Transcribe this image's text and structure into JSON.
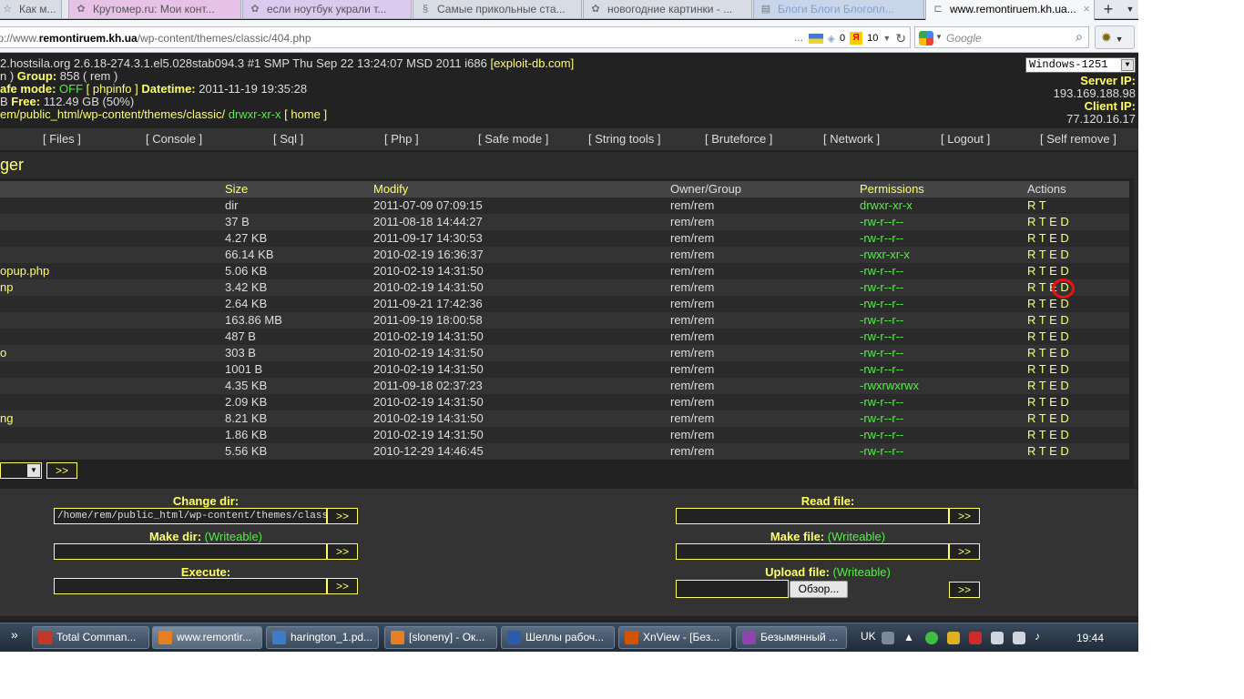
{
  "browser": {
    "tabs": [
      {
        "label": "Как м...",
        "fav": "☆"
      },
      {
        "label": "Крутомер.ru: Мои конт...",
        "fav": "✿"
      },
      {
        "label": "если ноутбук украли т...",
        "fav": "✿"
      },
      {
        "label": "Самые прикольные ста...",
        "fav": "§"
      },
      {
        "label": "новогодние картинки - ...",
        "fav": "✿"
      },
      {
        "label": "Блоги Блоги Блогопл...",
        "fav": "▤"
      },
      {
        "label": "www.remontiruem.kh.ua...",
        "fav": "⊏"
      }
    ],
    "new_tab": "+",
    "url_prefix": "http://www.",
    "url_host": "remontiruem.kh.ua",
    "url_path": "/wp-content/themes/classic/404.php",
    "counter_a": "0",
    "counter_b": "10",
    "search_placeholder": "Google"
  },
  "header": {
    "uname": "2.hostsila.org 2.6.18-274.3.1.el5.028stab094.3 #1 SMP Thu Sep 22 13:24:07 MSD 2011 i686",
    "exploit_link": "[exploit-db.com]",
    "user_tail": "n ) ",
    "group_label": "Group:",
    "group_value": "858 ( rem )",
    "safe_label": "afe mode:",
    "safe_value": "OFF",
    "phpinfo": "[ phpinfo ]",
    "datetime_label": "Datetime:",
    "datetime_value": "2011-11-19 19:35:28",
    "free_prefix": "B",
    "free_label": "Free:",
    "free_value": "112.49 GB (50%)",
    "path": "em/public_html/wp-content/themes/classic/",
    "path_perm": "drwxr-xr-x",
    "home_link": "[ home ]",
    "encoding": "Windows-1251",
    "server_ip_label": "Server IP:",
    "server_ip": "193.169.188.98",
    "client_ip_label": "Client IP:",
    "client_ip": "77.120.16.17"
  },
  "menu": [
    "[ Files ]",
    "[ Console ]",
    "[ Sql ]",
    "[ Php ]",
    "[ Safe mode ]",
    "[ String tools ]",
    "[ Bruteforce ]",
    "[ Network ]",
    "[ Logout ]",
    "[ Self remove ]"
  ],
  "section_title": "ger",
  "table": {
    "columns": [
      "Size",
      "Modify",
      "Owner/Group",
      "Permissions",
      "Actions"
    ],
    "rows": [
      {
        "name": "",
        "size": "dir",
        "modify": "2011-07-09 07:09:15",
        "owner": "rem/rem",
        "perms": "drwxr-xr-x",
        "actions": "R T"
      },
      {
        "name": "",
        "size": "37 B",
        "modify": "2011-08-18 14:44:27",
        "owner": "rem/rem",
        "perms": "-rw-r--r--",
        "actions": "R T E D"
      },
      {
        "name": "",
        "size": "4.27 KB",
        "modify": "2011-09-17 14:30:53",
        "owner": "rem/rem",
        "perms": "-rw-r--r--",
        "actions": "R T E D"
      },
      {
        "name": "",
        "size": "66.14 KB",
        "modify": "2010-02-19 16:36:37",
        "owner": "rem/rem",
        "perms": "-rwxr-xr-x",
        "actions": "R T E D"
      },
      {
        "name": "opup.php",
        "size": "5.06 KB",
        "modify": "2010-02-19 14:31:50",
        "owner": "rem/rem",
        "perms": "-rw-r--r--",
        "actions": "R T E D"
      },
      {
        "name": "np",
        "size": "3.42 KB",
        "modify": "2010-02-19 14:31:50",
        "owner": "rem/rem",
        "perms": "-rw-r--r--",
        "actions": "R T E D"
      },
      {
        "name": "",
        "size": "2.64 KB",
        "modify": "2011-09-21 17:42:36",
        "owner": "rem/rem",
        "perms": "-rw-r--r--",
        "actions": "R T E D"
      },
      {
        "name": "",
        "size": "163.86 MB",
        "modify": "2011-09-19 18:00:58",
        "owner": "rem/rem",
        "perms": "-rw-r--r--",
        "actions": "R T E D"
      },
      {
        "name": "",
        "size": "487 B",
        "modify": "2010-02-19 14:31:50",
        "owner": "rem/rem",
        "perms": "-rw-r--r--",
        "actions": "R T E D"
      },
      {
        "name": "o",
        "size": "303 B",
        "modify": "2010-02-19 14:31:50",
        "owner": "rem/rem",
        "perms": "-rw-r--r--",
        "actions": "R T E D"
      },
      {
        "name": "",
        "size": "1001 B",
        "modify": "2010-02-19 14:31:50",
        "owner": "rem/rem",
        "perms": "-rw-r--r--",
        "actions": "R T E D"
      },
      {
        "name": "",
        "size": "4.35 KB",
        "modify": "2011-09-18 02:37:23",
        "owner": "rem/rem",
        "perms": "-rwxrwxrwx",
        "actions": "R T E D"
      },
      {
        "name": "",
        "size": "2.09 KB",
        "modify": "2010-02-19 14:31:50",
        "owner": "rem/rem",
        "perms": "-rw-r--r--",
        "actions": "R T E D"
      },
      {
        "name": "ng",
        "size": "8.21 KB",
        "modify": "2010-02-19 14:31:50",
        "owner": "rem/rem",
        "perms": "-rw-r--r--",
        "actions": "R T E D"
      },
      {
        "name": "",
        "size": "1.86 KB",
        "modify": "2010-02-19 14:31:50",
        "owner": "rem/rem",
        "perms": "-rw-r--r--",
        "actions": "R T E D"
      },
      {
        "name": "",
        "size": "5.56 KB",
        "modify": "2010-12-29 14:46:45",
        "owner": "rem/rem",
        "perms": "-rw-r--r--",
        "actions": "R T E D"
      }
    ]
  },
  "go_label": ">>",
  "forms": {
    "change_dir_label": "Change dir:",
    "change_dir_value": "/home/rem/public_html/wp-content/themes/classic/",
    "make_dir_label": "Make dir:",
    "writeable": "(Writeable)",
    "execute_label": "Execute:",
    "read_file_label": "Read file:",
    "make_file_label": "Make file:",
    "upload_file_label": "Upload file:",
    "browse_label": "Обзор..."
  },
  "taskbar": {
    "more": "»",
    "tasks": [
      {
        "label": "Total Comman...",
        "color": "#c0392b"
      },
      {
        "label": "www.remontir...",
        "color": "#e67e22"
      },
      {
        "label": "harington_1.pd...",
        "color": "#3d7cc9"
      },
      {
        "label": "[sloneny] - Ок...",
        "color": "#e67e22"
      },
      {
        "label": "Шеллы рабоч...",
        "color": "#2a5caa"
      },
      {
        "label": "XnView - [Без...",
        "color": "#d35400"
      },
      {
        "label": "Безымянный ...",
        "color": "#8e44ad"
      }
    ],
    "lang": "UK",
    "clock": "19:44"
  },
  "colors": {
    "accent_yellow": "#ffff66",
    "accent_green": "#55ee44",
    "annotation_red": "#ee1111"
  }
}
